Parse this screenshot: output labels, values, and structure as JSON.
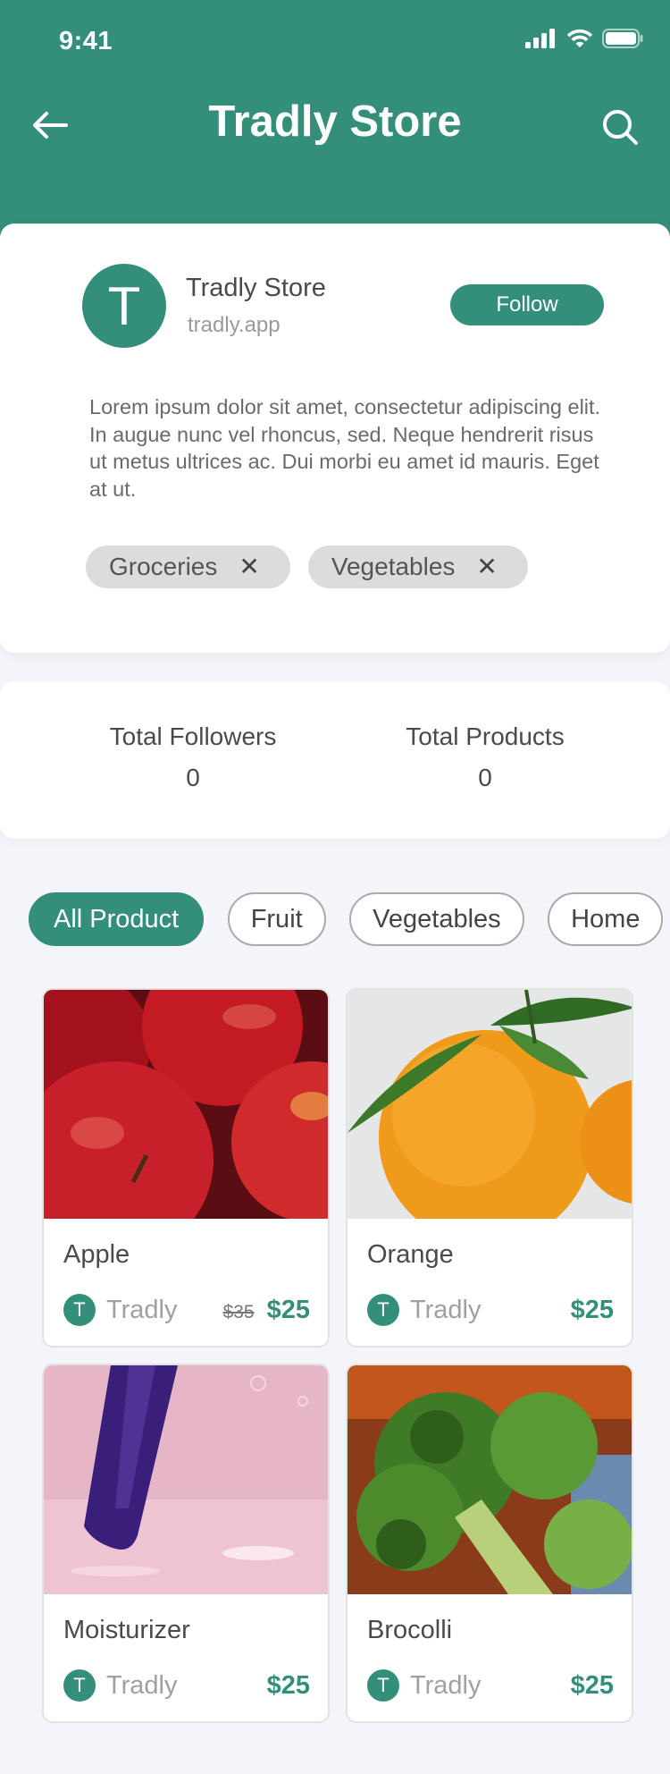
{
  "status_bar": {
    "time": "9:41"
  },
  "nav": {
    "title": "Tradly Store"
  },
  "store": {
    "avatar_letter": "T",
    "name": "Tradly Store",
    "url": "tradly.app",
    "follow_label": "Follow",
    "description": "Lorem ipsum dolor sit amet, consectetur adipiscing elit. In augue nunc vel rhoncus, sed. Neque hendrerit risus ut metus ultrices ac. Dui morbi eu amet id mauris. Eget at ut.",
    "tags": [
      {
        "label": "Groceries"
      },
      {
        "label": "Vegetables"
      }
    ]
  },
  "stats": {
    "followers_label": "Total Followers",
    "followers_value": "0",
    "products_label": "Total Products",
    "products_value": "0"
  },
  "filters": [
    {
      "label": "All Product",
      "active": true
    },
    {
      "label": "Fruit"
    },
    {
      "label": "Vegetables"
    },
    {
      "label": "Home"
    }
  ],
  "products": [
    {
      "name": "Apple",
      "seller_initial": "T",
      "seller": "Tradly",
      "old_price": "$35",
      "price": "$25"
    },
    {
      "name": "Orange",
      "seller_initial": "T",
      "seller": "Tradly",
      "old_price": "",
      "price": "$25"
    },
    {
      "name": "Moisturizer",
      "seller_initial": "T",
      "seller": "Tradly",
      "old_price": "",
      "price": "$25"
    },
    {
      "name": "Brocolli",
      "seller_initial": "T",
      "seller": "Tradly",
      "old_price": "",
      "price": "$25"
    }
  ],
  "colors": {
    "brand": "#338e7a",
    "background": "#f3f5fb",
    "card": "#ffffff"
  }
}
